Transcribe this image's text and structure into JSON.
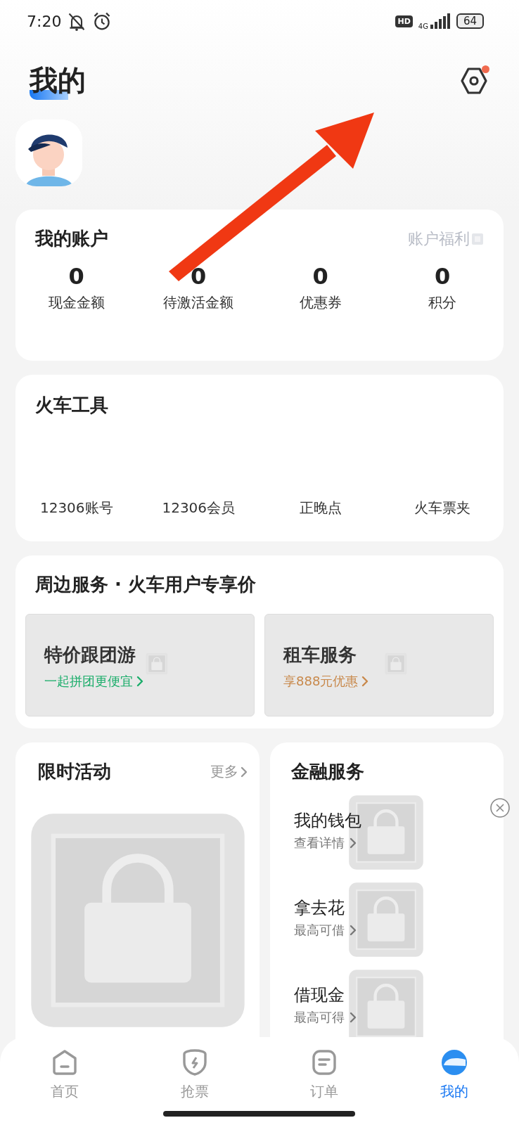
{
  "status_bar": {
    "time": "7:20",
    "hd": "HD",
    "network": "4G",
    "battery": "64"
  },
  "header": {
    "title": "我的",
    "notification_dot": true
  },
  "account": {
    "title": "我的账户",
    "link": "账户福利",
    "stats": [
      {
        "value": "0",
        "label": "现金金额"
      },
      {
        "value": "0",
        "label": "待激活金额"
      },
      {
        "value": "0",
        "label": "优惠券"
      },
      {
        "value": "0",
        "label": "积分"
      }
    ]
  },
  "train_tools": {
    "title": "火车工具",
    "items": [
      "12306账号",
      "12306会员",
      "正晚点",
      "火车票夹"
    ]
  },
  "services": {
    "title": "周边服务 · 火车用户专享价",
    "tiles": [
      {
        "title": "特价跟团游",
        "subtitle": "一起拼团更便宜",
        "color": "#1aad6a"
      },
      {
        "title": "租车服务",
        "subtitle": "享888元优惠",
        "color": "#c8884a"
      }
    ]
  },
  "activities": {
    "title": "限时活动",
    "more": "更多"
  },
  "finance": {
    "title": "金融服务",
    "items": [
      {
        "title": "我的钱包",
        "subtitle": "查看详情"
      },
      {
        "title": "拿去花",
        "subtitle": "最高可借"
      },
      {
        "title": "借现金",
        "subtitle": "最高可得"
      }
    ]
  },
  "tab_bar": [
    {
      "label": "首页",
      "selected": false
    },
    {
      "label": "抢票",
      "selected": false
    },
    {
      "label": "订单",
      "selected": false
    },
    {
      "label": "我的",
      "selected": true
    }
  ]
}
